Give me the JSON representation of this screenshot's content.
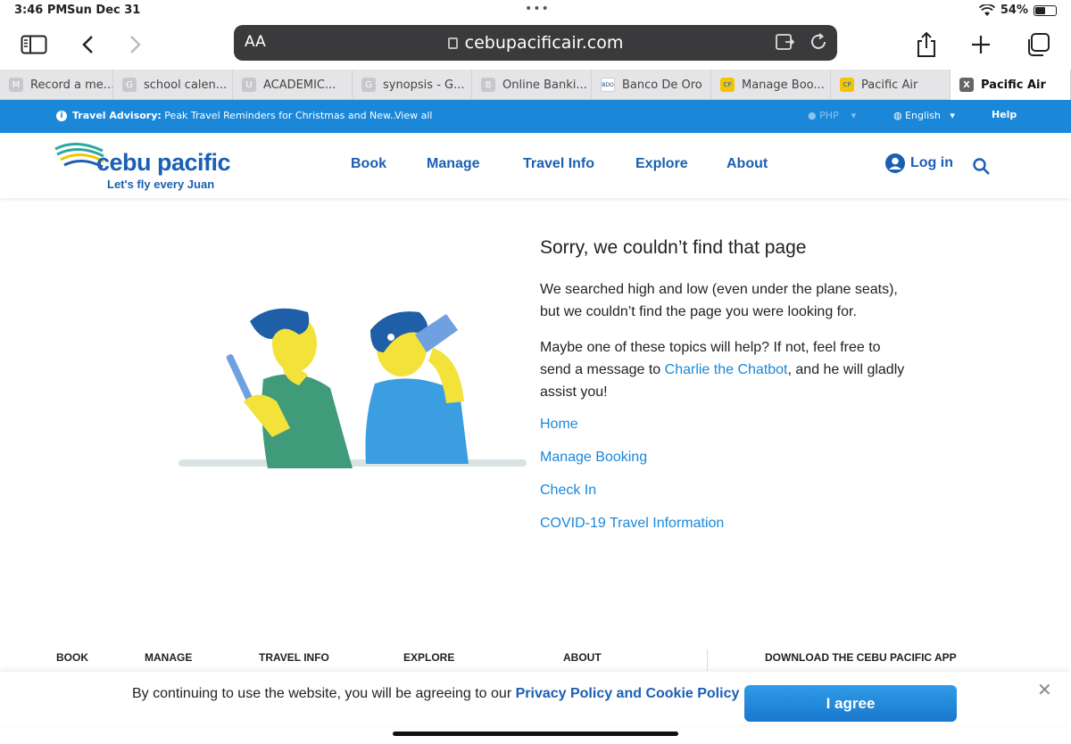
{
  "status_bar": {
    "time": "3:46 PM",
    "date": "Sun Dec 31",
    "battery": "54%",
    "battery_level": 0.54
  },
  "browser": {
    "text_size_label": "AA",
    "url": "cebupacificair.com",
    "tabs": [
      {
        "label": "Record a me...",
        "favicon": "M"
      },
      {
        "label": "school calen...",
        "favicon": "G"
      },
      {
        "label": "ACADEMIC...",
        "favicon": "U"
      },
      {
        "label": "synopsis - G...",
        "favicon": "G"
      },
      {
        "label": "Online Banki...",
        "favicon": "B"
      },
      {
        "label": "Banco De Oro",
        "favicon": "BDO"
      },
      {
        "label": "Manage Boo...",
        "favicon": "CP"
      },
      {
        "label": "Pacific Air",
        "favicon": "CP"
      },
      {
        "label": "Pacific Air",
        "favicon": "X"
      }
    ]
  },
  "advisory": {
    "title": "Travel Advisory:",
    "text": " Peak Travel Reminders for Christmas and New...",
    "view_all": "View all",
    "currency": "PHP",
    "language": "English",
    "help": "Help"
  },
  "header": {
    "brand": "cebu pacific",
    "tagline": "Let's fly every Juan",
    "nav": [
      "Book",
      "Manage",
      "Travel Info",
      "Explore",
      "About"
    ],
    "login": "Log in"
  },
  "main": {
    "title": "Sorry, we couldn’t find that page",
    "para1": "We searched high and low (even under the plane seats), but we couldn’t find the page you were looking for.",
    "para2_before": "Maybe one of these topics will help? If not, feel free to send a message to ",
    "para2_link": "Charlie the Chatbot",
    "para2_after": ", and he will gladly assist you!",
    "links": [
      "Home",
      "Manage Booking",
      "Check In",
      "COVID-19 Travel Information"
    ]
  },
  "footer": {
    "columns": [
      "BOOK",
      "MANAGE",
      "TRAVEL INFO",
      "EXPLORE",
      "ABOUT"
    ],
    "app_download": "DOWNLOAD THE CEBU PACIFIC APP"
  },
  "cookie": {
    "message": "By continuing to use the website, you will be agreeing to our ",
    "policy_link": "Privacy Policy and Cookie Policy",
    "agree": "I agree"
  },
  "colors": {
    "brand_blue": "#1a5fb4",
    "advisory_blue": "#1a87d9",
    "link_blue": "#1a87d9"
  }
}
